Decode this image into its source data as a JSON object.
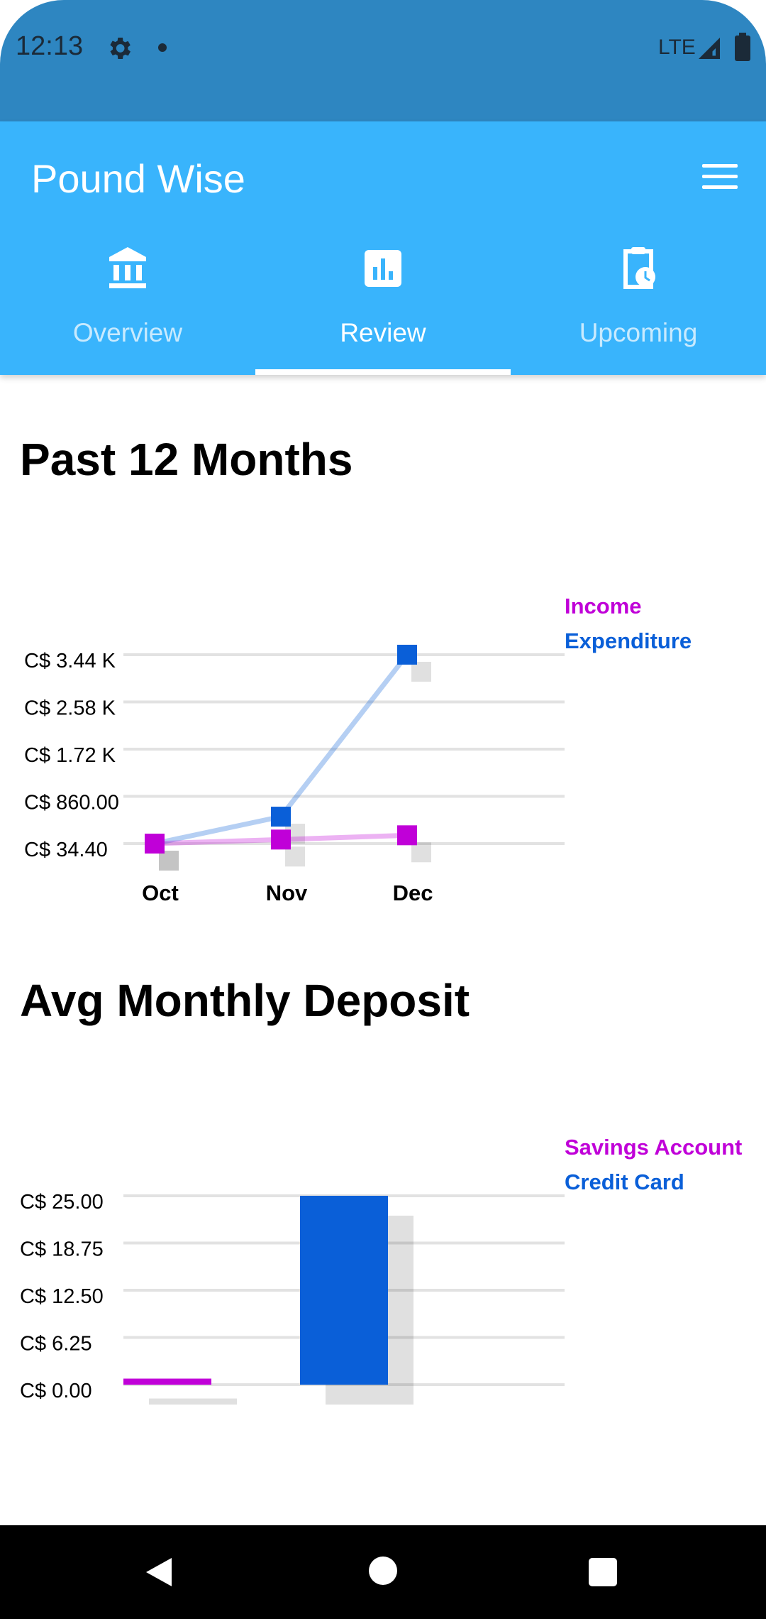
{
  "status_bar": {
    "time": "12:13",
    "network": "LTE",
    "icons": [
      "gear-icon",
      "notification-dot",
      "signal-icon",
      "battery-icon"
    ]
  },
  "app_bar": {
    "title": "Pound Wise",
    "menu_icon": "hamburger-menu-icon",
    "background_color": "#39b4fc"
  },
  "tabs": [
    {
      "label": "Overview",
      "icon": "bank-icon",
      "active": false
    },
    {
      "label": "Review",
      "icon": "bar-chart-icon",
      "active": true
    },
    {
      "label": "Upcoming",
      "icon": "clipboard-clock-icon",
      "active": false
    }
  ],
  "sections": {
    "past_months_title": "Past 12 Months",
    "avg_deposit_title": "Avg Monthly Deposit"
  },
  "colors": {
    "income": "#c000d8",
    "expenditure": "#0a5fd8",
    "savings_account": "#c000d8",
    "credit_card": "#0a5fd8",
    "grid": "#e2e2e2"
  },
  "chart_data": [
    {
      "type": "line",
      "title": "Past 12 Months",
      "categories": [
        "Oct",
        "Nov",
        "Dec"
      ],
      "series": [
        {
          "name": "Income",
          "values": [
            34.4,
            107,
            184
          ]
        },
        {
          "name": "Expenditure",
          "values": [
            34.4,
            520,
            3440
          ]
        }
      ],
      "y_tick_labels": [
        "C$ 3.44 K",
        "C$ 2.58 K",
        "C$ 1.72 K",
        "C$ 860.00",
        "C$ 34.40"
      ],
      "y_tick_values": [
        3440,
        2580,
        1720,
        860,
        34.4
      ],
      "ylim": [
        34.4,
        3440
      ],
      "legend_position": "top-right",
      "grid": true
    },
    {
      "type": "bar",
      "title": "Avg Monthly Deposit",
      "categories": [
        "Savings Account",
        "Credit Card"
      ],
      "series": [
        {
          "name": "Savings Account",
          "values": [
            0.8
          ]
        },
        {
          "name": "Credit Card",
          "values": [
            25.0
          ]
        }
      ],
      "y_tick_labels": [
        "C$ 25.00",
        "C$ 18.75",
        "C$ 12.50",
        "C$ 6.25",
        "C$ 0.00"
      ],
      "y_tick_values": [
        25,
        18.75,
        12.5,
        6.25,
        0
      ],
      "ylim": [
        0,
        25
      ],
      "legend_position": "top-right",
      "grid": true
    }
  ]
}
